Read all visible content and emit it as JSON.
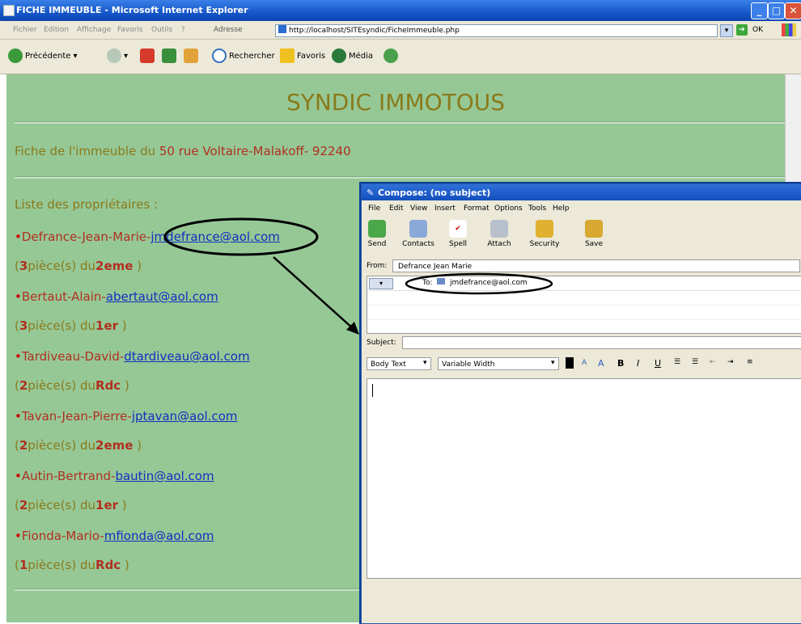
{
  "ie": {
    "title": "FICHE IMMEUBLE - Microsoft Internet Explorer",
    "menu": [
      "Fichier",
      "Edition",
      "Affichage",
      "Favoris",
      "Outils",
      "?"
    ],
    "address_label": "Adresse",
    "url": "http://localhost/SITEsyndic/FicheImmeuble.php",
    "go_label": "OK",
    "toolbar": {
      "back": "Précédente",
      "search": "Rechercher",
      "favorites": "Favoris",
      "media": "Média"
    }
  },
  "page": {
    "title": "SYNDIC IMMOTOUS",
    "building_prefix": "Fiche de l'immeuble du ",
    "building_address": "50 rue Voltaire-Malakoff- 92240",
    "owners_heading": "Liste des propriétaires :",
    "owners": [
      {
        "name": "Defrance-Jean-Marie-",
        "email": "jmdefrance@aol.com",
        "rooms": "3",
        "floor": "2eme"
      },
      {
        "name": "Bertaut-Alain-",
        "email": "abertaut@aol.com",
        "rooms": "3",
        "floor": "1er"
      },
      {
        "name": "Tardiveau-David-",
        "email": "dtardiveau@aol.com",
        "rooms": "2",
        "floor": "Rdc"
      },
      {
        "name": "Tavan-Jean-Pierre-",
        "email": "jptavan@aol.com",
        "rooms": "2",
        "floor": "2eme"
      },
      {
        "name": "Autin-Bertrand-",
        "email": "bautin@aol.com",
        "rooms": "2",
        "floor": "1er"
      },
      {
        "name": "Fionda-Mario-",
        "email": "mfionda@aol.com",
        "rooms": "1",
        "floor": "Rdc"
      }
    ],
    "rooms_suffix": "pièce(s) du"
  },
  "compose": {
    "title": "Compose: (no subject)",
    "menu": [
      "File",
      "Edit",
      "View",
      "Insert",
      "Format",
      "Options",
      "Tools",
      "Help"
    ],
    "toolbar": [
      "Send",
      "Contacts",
      "Spell",
      "Attach",
      "Security",
      "Save"
    ],
    "from_label": "From:",
    "from_value": "Defrance Jean Marie",
    "to_label": "To:",
    "to_value": "jmdefrance@aol.com",
    "subject_label": "Subject:",
    "subject_value": "",
    "format_style": "Body Text",
    "format_font": "Variable Width",
    "format_buttons": [
      "B",
      "I",
      "U"
    ]
  },
  "colors": {
    "page_bg": "#96c896",
    "title_color": "#8a7a1a",
    "owner_red": "#b03020",
    "link": "#1030c0"
  }
}
